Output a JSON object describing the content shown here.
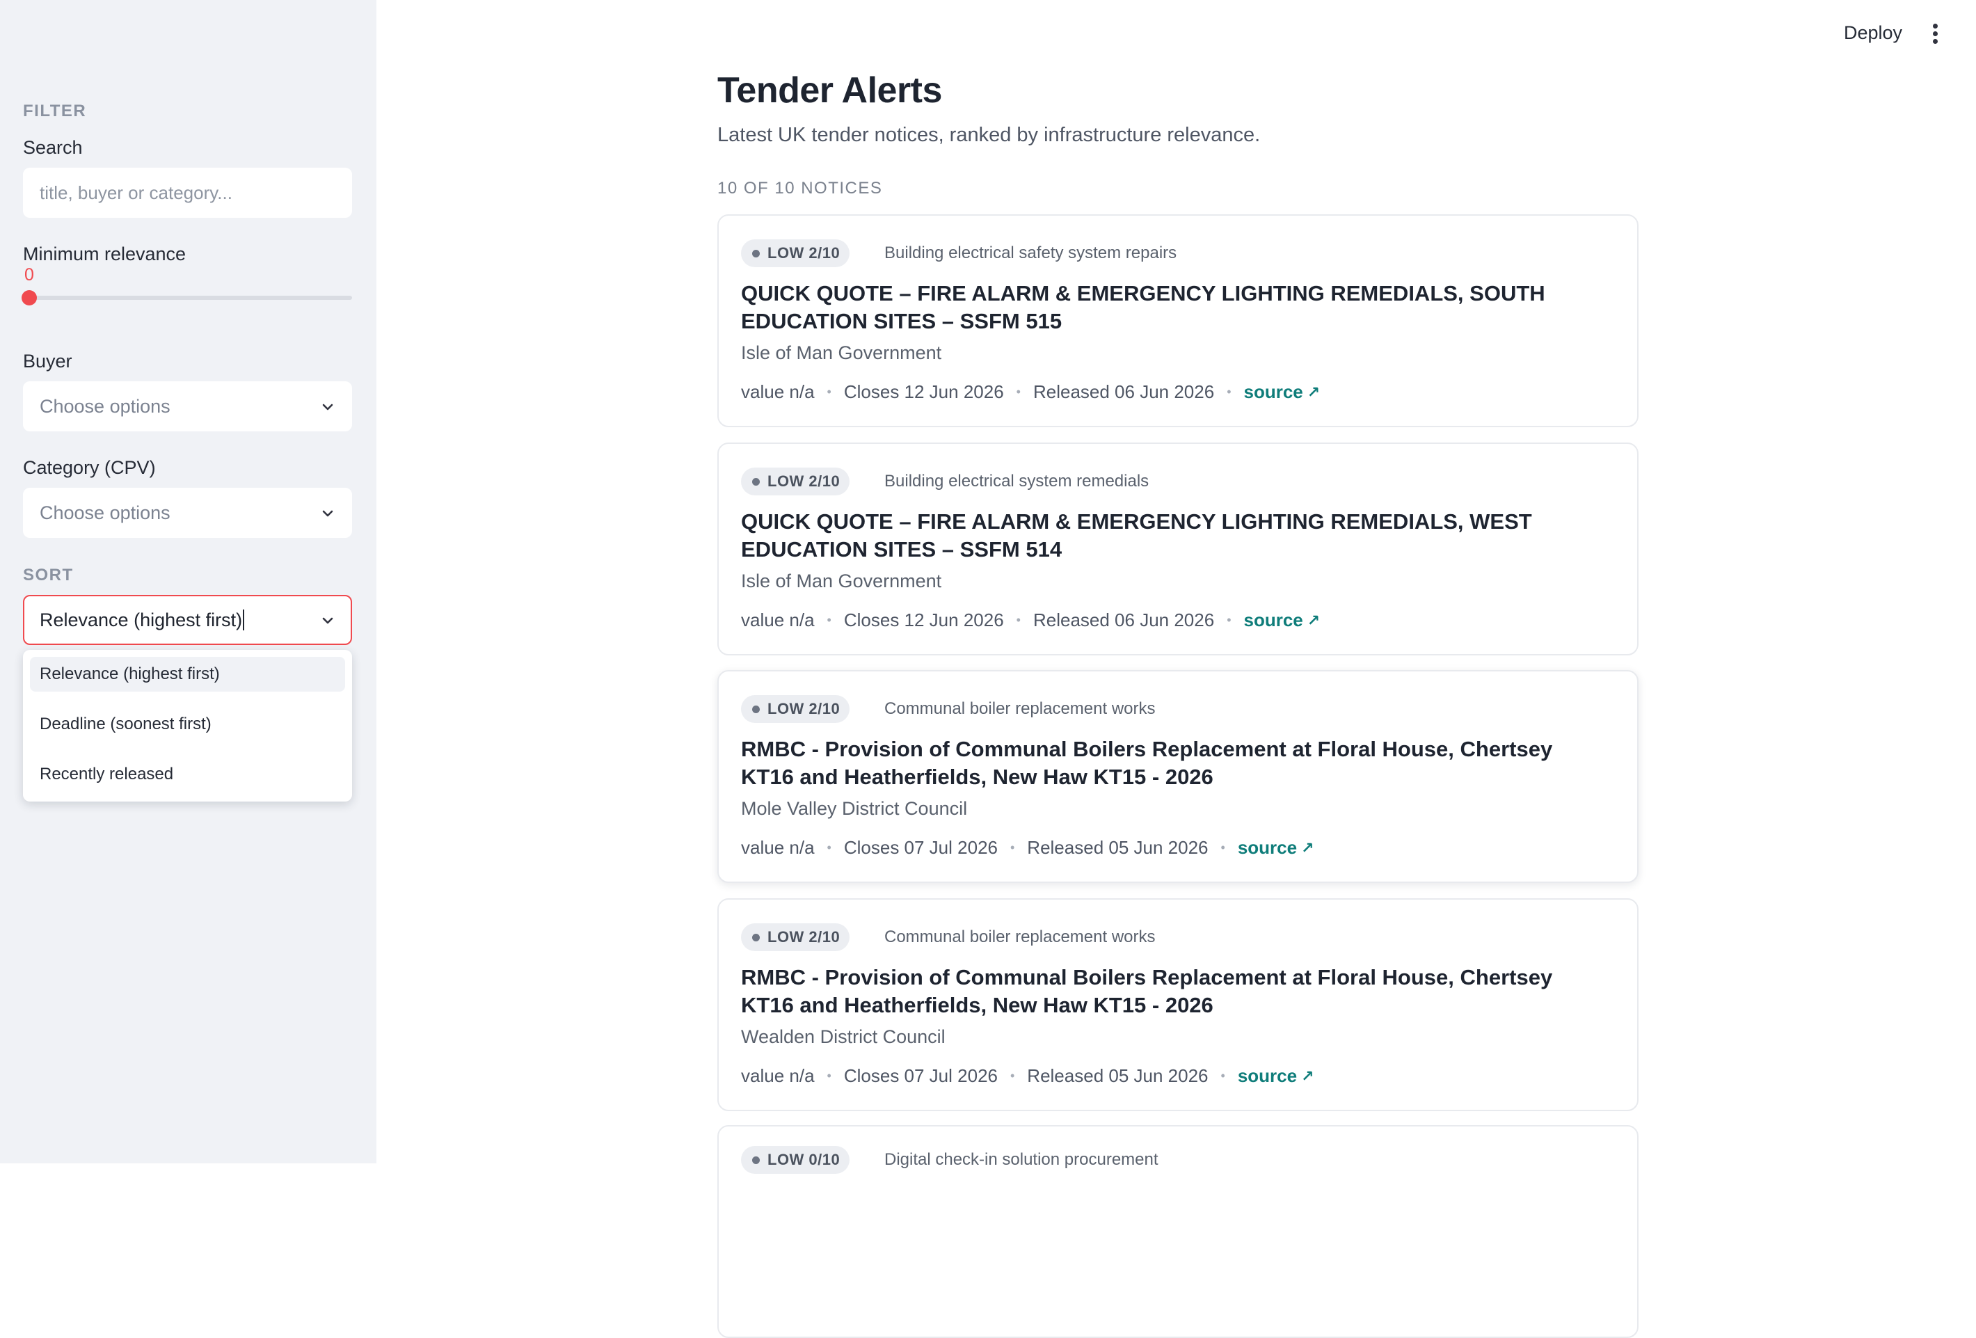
{
  "header": {
    "deploy_label": "Deploy",
    "menu_icon": "kebab-menu-icon"
  },
  "sidebar": {
    "filter_heading": "FILTER",
    "search": {
      "label": "Search",
      "placeholder": "title, buyer or category..."
    },
    "min_relevance": {
      "label": "Minimum relevance",
      "value": "0"
    },
    "buyer": {
      "label": "Buyer",
      "placeholder": "Choose options"
    },
    "category": {
      "label": "Category (CPV)",
      "placeholder": "Choose options"
    },
    "sort_heading": "SORT",
    "sort": {
      "selected": "Relevance (highest first)",
      "options": [
        "Relevance (highest first)",
        "Deadline (soonest first)",
        "Recently released"
      ]
    }
  },
  "main": {
    "title": "Tender Alerts",
    "subtitle": "Latest UK tender notices, ranked by infrastructure relevance.",
    "count": "10 OF 10 NOTICES",
    "notices": [
      {
        "badge": "LOW 2/10",
        "category": "Building electrical safety system repairs",
        "title": "QUICK QUOTE – FIRE ALARM & EMERGENCY LIGHTING REMEDIALS, SOUTH EDUCATION SITES – SSFM 515",
        "buyer": "Isle of Man Government",
        "value": "value n/a",
        "closes": "Closes 12 Jun 2026",
        "released": "Released 06 Jun 2026",
        "source": "source"
      },
      {
        "badge": "LOW 2/10",
        "category": "Building electrical system remedials",
        "title": "QUICK QUOTE – FIRE ALARM & EMERGENCY LIGHTING REMEDIALS, WEST EDUCATION SITES – SSFM 514",
        "buyer": "Isle of Man Government",
        "value": "value n/a",
        "closes": "Closes 12 Jun 2026",
        "released": "Released 06 Jun 2026",
        "source": "source"
      },
      {
        "badge": "LOW 2/10",
        "category": "Communal boiler replacement works",
        "title": "RMBC - Provision of Communal Boilers Replacement at Floral House, Chertsey KT16 and Heatherfields, New Haw KT15 - 2026",
        "buyer": "Mole Valley District Council",
        "value": "value n/a",
        "closes": "Closes 07 Jul 2026",
        "released": "Released 05 Jun 2026",
        "source": "source"
      },
      {
        "badge": "LOW 2/10",
        "category": "Communal boiler replacement works",
        "title": "RMBC - Provision of Communal Boilers Replacement at Floral House, Chertsey KT16 and Heatherfields, New Haw KT15 - 2026",
        "buyer": "Wealden District Council",
        "value": "value n/a",
        "closes": "Closes 07 Jul 2026",
        "released": "Released 05 Jun 2026",
        "source": "source"
      },
      {
        "badge": "LOW 0/10",
        "category": "Digital check-in solution procurement"
      }
    ]
  },
  "colors": {
    "accent": "#f04a4f",
    "link": "#0f7d7a",
    "sidebar_bg": "#f0f2f6"
  }
}
